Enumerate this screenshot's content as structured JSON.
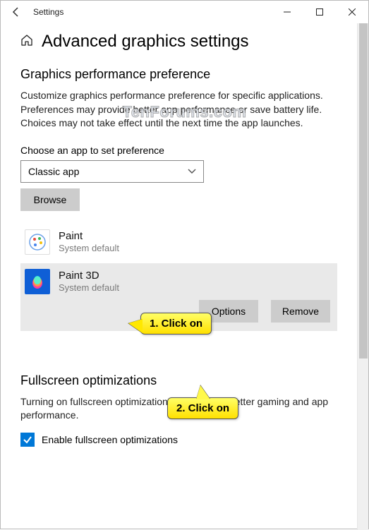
{
  "window": {
    "title": "Settings"
  },
  "page": {
    "title": "Advanced graphics settings"
  },
  "graphics": {
    "heading": "Graphics performance preference",
    "description": "Customize graphics performance preference for specific applications. Preferences may provide better app performance or save battery life. Choices may not take effect until the next time the app launches.",
    "choose_label": "Choose an app to set preference",
    "dropdown_value": "Classic app",
    "browse_label": "Browse",
    "apps": [
      {
        "name": "Paint",
        "sub": "System default"
      },
      {
        "name": "Paint 3D",
        "sub": "System default"
      }
    ],
    "options_label": "Options",
    "remove_label": "Remove"
  },
  "fullscreen": {
    "heading": "Fullscreen optimizations",
    "description": "Turning on fullscreen optimizations may lead to better gaming and app performance.",
    "checkbox_label": "Enable fullscreen optimizations"
  },
  "annotations": {
    "step1": "1. Click on",
    "step2": "2. Click on"
  },
  "watermark": "TenForums.com"
}
